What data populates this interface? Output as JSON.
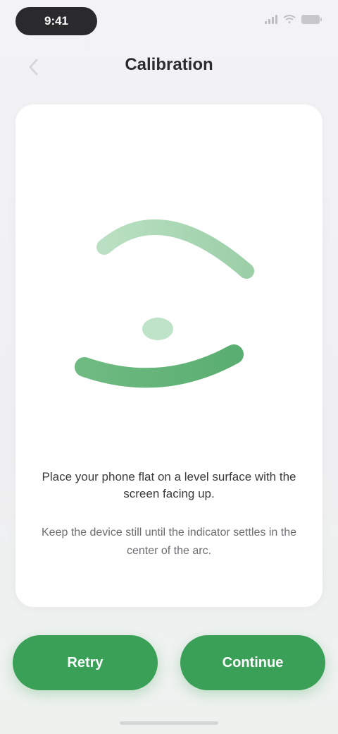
{
  "status_bar": {
    "time": "9:41",
    "icons": [
      "cellular-signal-icon",
      "wifi-icon",
      "battery-icon"
    ]
  },
  "nav": {
    "back_icon": "chevron-left-icon",
    "title": "Calibration"
  },
  "card": {
    "illustration": "level-gauge-illustration",
    "instruction_primary": "Place your phone flat on a level surface with the screen facing up.",
    "instruction_secondary": "Keep the device still until the indicator settles in the center of the arc."
  },
  "buttons": {
    "left_label": "Retry",
    "right_label": "Continue"
  },
  "colors": {
    "accent": "#3aa057",
    "accent_light": "#a8d8b3",
    "title": "#2c2c2e"
  }
}
